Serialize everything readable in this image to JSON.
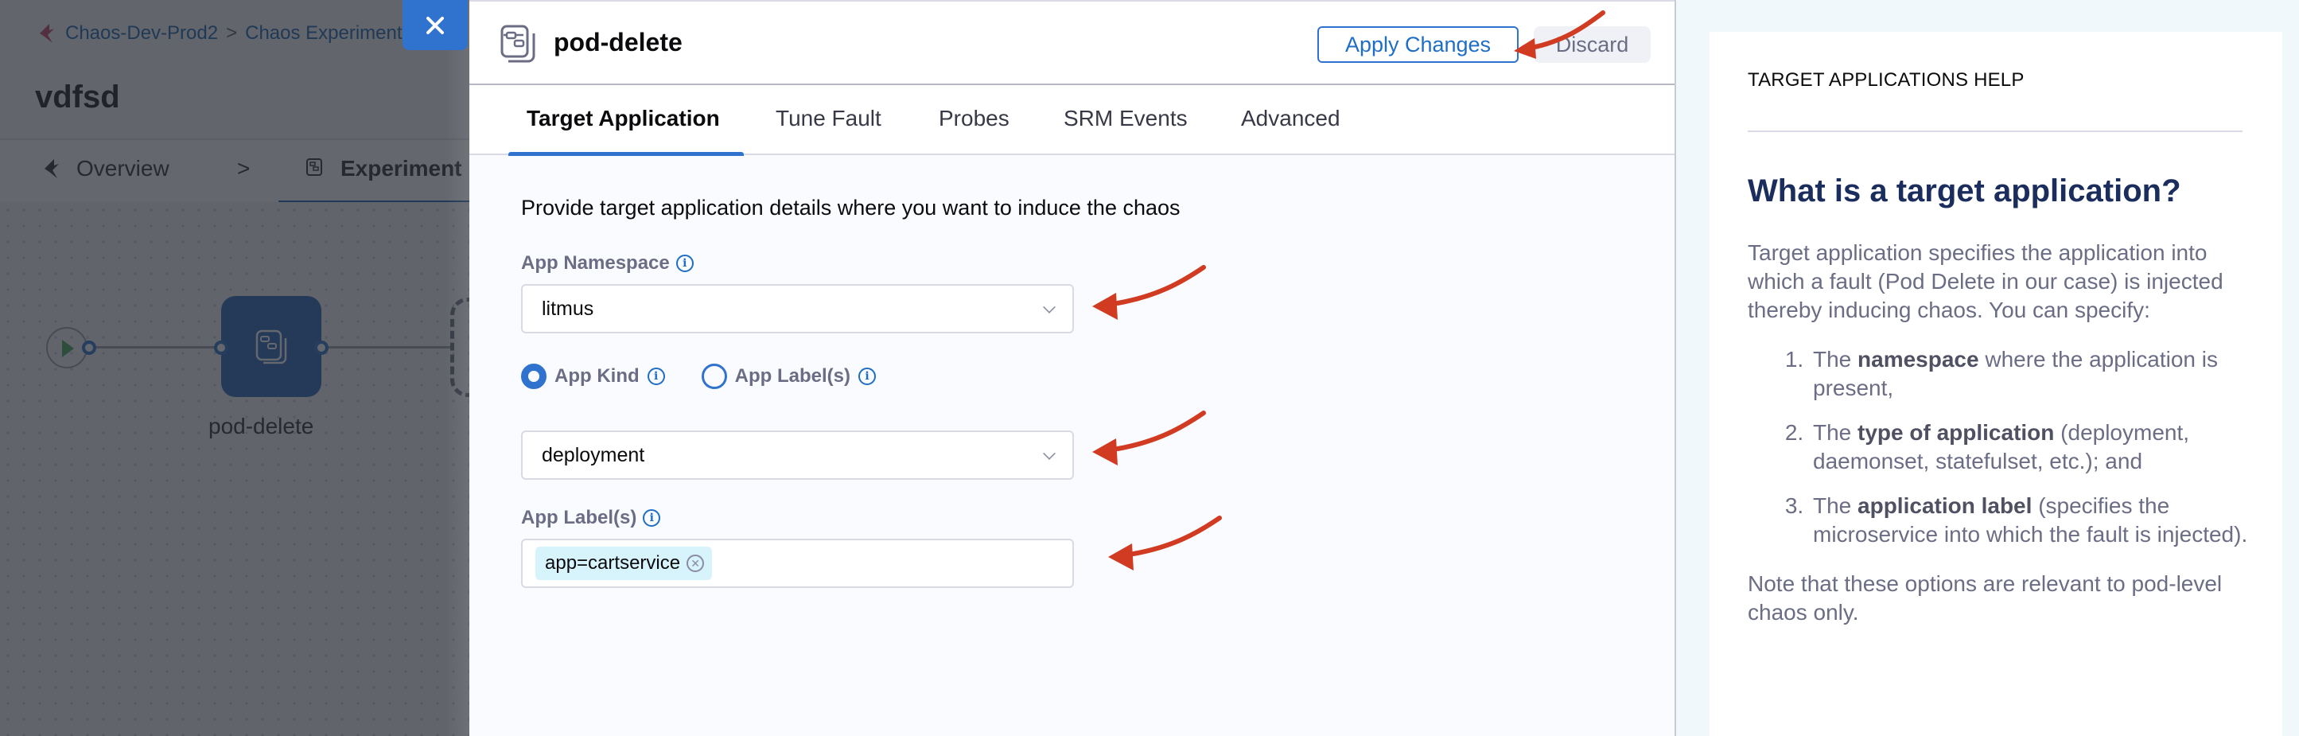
{
  "background_app": {
    "breadcrumb": [
      "Chaos-Dev-Prod2",
      "Chaos Experiments"
    ],
    "breadcrumb_separator": ">",
    "experiment_name": "vdfsd",
    "tabs": [
      {
        "label": "Overview"
      },
      {
        "label": "Experiment Builder"
      }
    ],
    "tab_separator": ">",
    "node_label": "pod-delete"
  },
  "drawer": {
    "close_icon": "close-icon",
    "title": "pod-delete",
    "title_icon": "fault-icon",
    "apply_label": "Apply Changes",
    "discard_label": "Discard",
    "tabs": [
      {
        "label": "Target Application",
        "active": true
      },
      {
        "label": "Tune Fault",
        "active": false
      },
      {
        "label": "Probes",
        "active": false
      },
      {
        "label": "SRM Events",
        "active": false
      },
      {
        "label": "Advanced",
        "active": false
      }
    ],
    "form": {
      "intro": "Provide target application details where you want to induce the chaos",
      "namespace": {
        "label": "App Namespace",
        "value": "litmus"
      },
      "target_mode": {
        "options": [
          {
            "label": "App Kind",
            "checked": true
          },
          {
            "label": "App Label(s)",
            "checked": false
          }
        ]
      },
      "app_kind": {
        "value": "deployment"
      },
      "app_labels": {
        "label": "App Label(s)",
        "chips": [
          "app=cartservice"
        ]
      }
    }
  },
  "help": {
    "kicker": "TARGET APPLICATIONS HELP",
    "heading": "What is a target application?",
    "intro": "Target application specifies the application into which a fault (Pod Delete in our case) is injected thereby inducing chaos. You can specify:",
    "items": [
      {
        "prefix": "The ",
        "bold": "namespace",
        "suffix": " where the application is present,"
      },
      {
        "prefix": "The ",
        "bold": "type of application",
        "suffix": " (deployment, daemonset, statefulset, etc.); and"
      },
      {
        "prefix": "The ",
        "bold": "application label",
        "suffix": " (specifies the microservice into which the fault is injected)."
      }
    ],
    "note": "Note that these options are relevant to pod-level chaos only."
  },
  "colors": {
    "accent": "#3073cf",
    "annotation_arrow": "#d13b22",
    "heading": "#1a2d5c",
    "chip_bg": "#d7f3fb",
    "help_bg": "#f0f8fb"
  }
}
